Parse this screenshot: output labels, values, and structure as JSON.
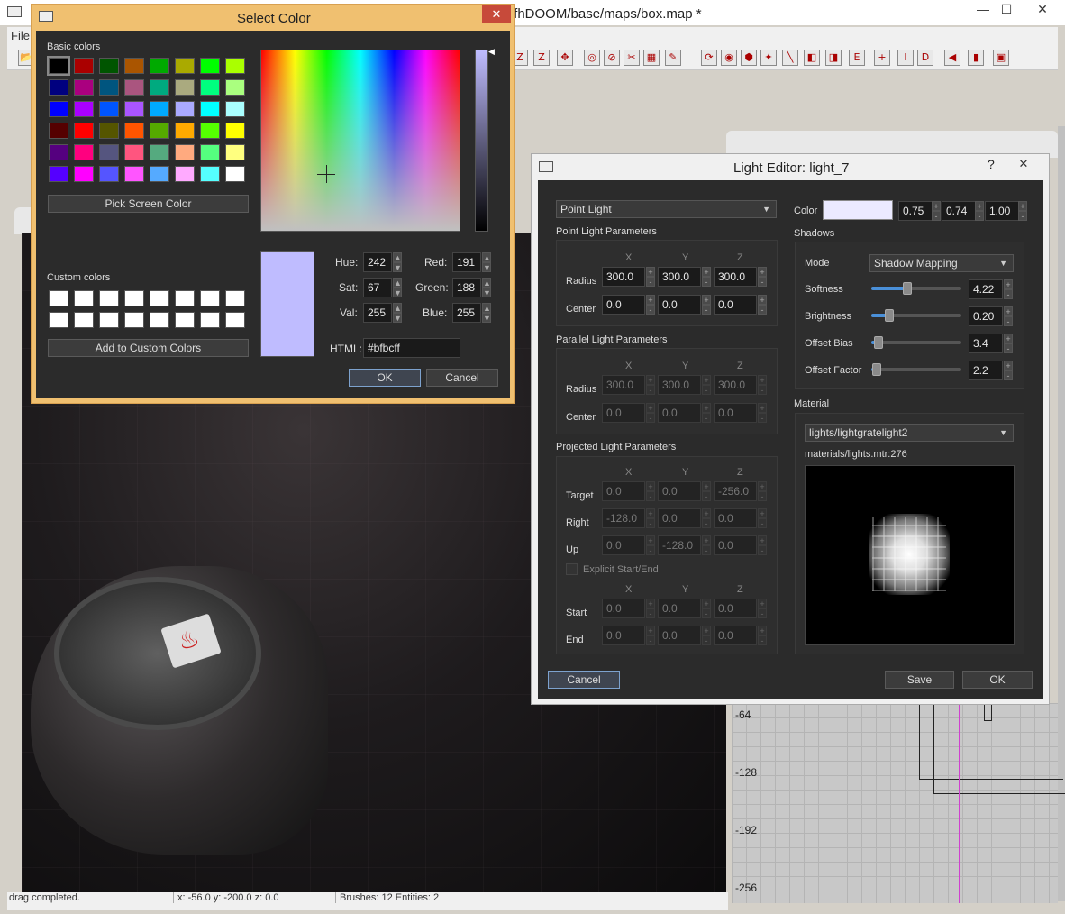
{
  "main_window": {
    "title": "/fhDOOM/base/maps/box.map *",
    "menu_first": "File",
    "status": {
      "left": "drag completed.",
      "mid": "x:  -56.0  y:  -200.0  z:  0.0",
      "right": "Brushes: 12 Entities: 2"
    },
    "grid_labels": [
      "-64",
      "-128",
      "-192",
      "-256"
    ],
    "toolbar_icons": [
      "open-icon",
      "z-icon",
      "z-icon",
      "move-icon",
      "circle-icon",
      "stop-icon",
      "clip-icon",
      "clip2-icon",
      "paint-icon",
      "rotate-icon",
      "camera-icon",
      "brush-icon",
      "pick-icon",
      "line-icon",
      "entity-icon",
      "entity2-icon",
      "edit-icon",
      "add-icon",
      "ins-icon",
      "del-icon",
      "speaker-icon",
      "book-icon",
      "image-icon"
    ]
  },
  "select_color": {
    "title": "Select Color",
    "basic_colors_label": "Basic colors",
    "basic_colors": [
      "#000000",
      "#aa0000",
      "#005500",
      "#aa5500",
      "#00aa00",
      "#aaaa00",
      "#00ff00",
      "#aaff00",
      "#00007f",
      "#aa007f",
      "#00557f",
      "#aa557f",
      "#00aa7f",
      "#aaaa7f",
      "#00ff7f",
      "#aaff7f",
      "#0000ff",
      "#aa00ff",
      "#0055ff",
      "#aa55ff",
      "#00aaff",
      "#aaaaff",
      "#00ffff",
      "#aaffff",
      "#550000",
      "#ff0000",
      "#555500",
      "#ff5500",
      "#55aa00",
      "#ffaa00",
      "#55ff00",
      "#ffff00",
      "#55007f",
      "#ff007f",
      "#55557f",
      "#ff557f",
      "#55aa7f",
      "#ffaa7f",
      "#55ff7f",
      "#ffff7f",
      "#5500ff",
      "#ff00ff",
      "#5555ff",
      "#ff55ff",
      "#55aaff",
      "#ffaaff",
      "#55ffff",
      "#ffffff"
    ],
    "pick_screen": "Pick Screen Color",
    "custom_colors_label": "Custom colors",
    "add_custom": "Add to Custom Colors",
    "hue_label": "Hue:",
    "hue": "242",
    "sat_label": "Sat:",
    "sat": "67",
    "val_label": "Val:",
    "val": "255",
    "red_label": "Red:",
    "red": "191",
    "green_label": "Green:",
    "green": "188",
    "blue_label": "Blue:",
    "blue": "255",
    "html_label": "HTML:",
    "html": "#bfbcff",
    "ok": "OK",
    "cancel": "Cancel",
    "current_color": "#bfbcff"
  },
  "light_editor": {
    "title": "Light Editor: light_7",
    "help": "?",
    "type": "Point Light",
    "color_label": "Color",
    "color_r": "0.75",
    "color_g": "0.74",
    "color_b": "1.00",
    "point": {
      "title": "Point Light Parameters",
      "x": "X",
      "y": "Y",
      "z": "Z",
      "radius_label": "Radius",
      "radius": [
        "300.0",
        "300.0",
        "300.0"
      ],
      "center_label": "Center",
      "center": [
        "0.0",
        "0.0",
        "0.0"
      ]
    },
    "parallel": {
      "title": "Parallel Light Parameters",
      "x": "X",
      "y": "Y",
      "z": "Z",
      "radius_label": "Radius",
      "radius": [
        "300.0",
        "300.0",
        "300.0"
      ],
      "center_label": "Center",
      "center": [
        "0.0",
        "0.0",
        "0.0"
      ]
    },
    "projected": {
      "title": "Projected Light Parameters",
      "x": "X",
      "y": "Y",
      "z": "Z",
      "target_label": "Target",
      "target": [
        "0.0",
        "0.0",
        "-256.0"
      ],
      "right_label": "Right",
      "right": [
        "-128.0",
        "0.0",
        "0.0"
      ],
      "up_label": "Up",
      "up": [
        "0.0",
        "-128.0",
        "0.0"
      ],
      "explicit": "Explicit Start/End",
      "start_label": "Start",
      "start": [
        "0.0",
        "0.0",
        "0.0"
      ],
      "end_label": "End",
      "end": [
        "0.0",
        "0.0",
        "0.0"
      ]
    },
    "shadows": {
      "title": "Shadows",
      "mode_label": "Mode",
      "mode": "Shadow Mapping",
      "softness_label": "Softness",
      "softness": "4.22",
      "softness_level": 0.4,
      "brightness_label": "Brightness",
      "brightness": "0.20",
      "brightness_level": 0.2,
      "offset_bias_label": "Offset Bias",
      "offset_bias": "3.4",
      "offset_bias_level": 0.08,
      "offset_factor_label": "Offset Factor",
      "offset_factor": "2.2",
      "offset_factor_level": 0.06
    },
    "material": {
      "title": "Material",
      "name": "lights/lightgratelight2",
      "file": "materials/lights.mtr:276"
    },
    "cancel": "Cancel",
    "save": "Save",
    "ok": "OK"
  }
}
